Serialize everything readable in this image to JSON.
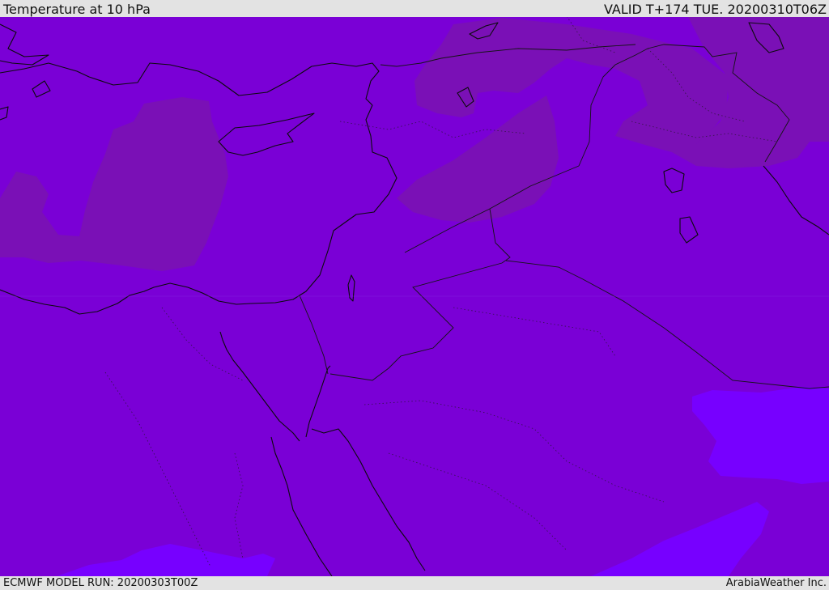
{
  "header": {
    "title": "Temperature at 10 hPa",
    "valid": "VALID T+174 TUE. 20200310T06Z"
  },
  "footer": {
    "model_run": "ECMWF MODEL RUN: 20200303T00Z",
    "credit": "ArabiaWeather Inc."
  },
  "map": {
    "colors": {
      "base_field": "#7a00d6",
      "warmer_field": "#7a10b6",
      "colder_field": "#7700ff",
      "coastline": "#0b0b0b",
      "border": "#141414"
    }
  }
}
